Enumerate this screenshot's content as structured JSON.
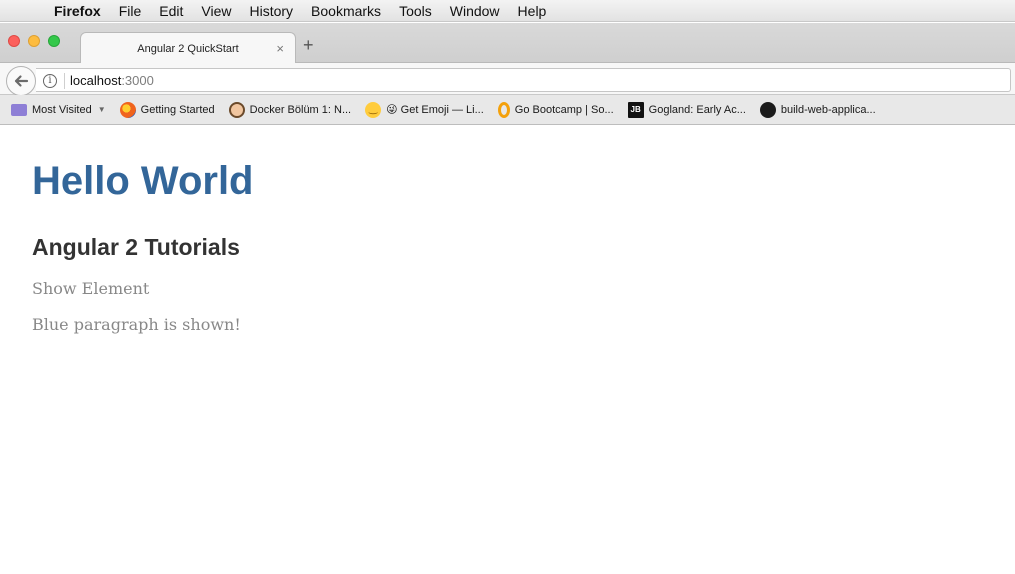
{
  "menubar": {
    "app": "Firefox",
    "items": [
      "File",
      "Edit",
      "View",
      "History",
      "Bookmarks",
      "Tools",
      "Window",
      "Help"
    ]
  },
  "tab": {
    "title": "Angular 2 QuickStart",
    "close": "×",
    "new": "+"
  },
  "navbar": {
    "url_host": "localhost",
    "url_port": ":3000",
    "info": "i"
  },
  "bookmarks": [
    {
      "label": "Most Visited",
      "icon": "folder-icon"
    },
    {
      "label": "Getting Started",
      "icon": "firefox-icon"
    },
    {
      "label": "Docker Bölüm 1: N...",
      "icon": "avatar-icon"
    },
    {
      "label": "😜 Get Emoji — Li...",
      "icon": "emoji-icon"
    },
    {
      "label": "Go Bootcamp | So...",
      "icon": "opera-icon"
    },
    {
      "label": "Gogland: Early Ac...",
      "icon": "jetbrains-icon"
    },
    {
      "label": "build-web-applica...",
      "icon": "github-icon"
    }
  ],
  "page": {
    "heading": "Hello World",
    "subheading": "Angular 2 Tutorials",
    "toggle_label": "Show Element",
    "paragraph": "Blue paragraph is shown!"
  },
  "colors": {
    "heading": "#336699",
    "subheading": "#333333",
    "body_text": "#888888"
  }
}
